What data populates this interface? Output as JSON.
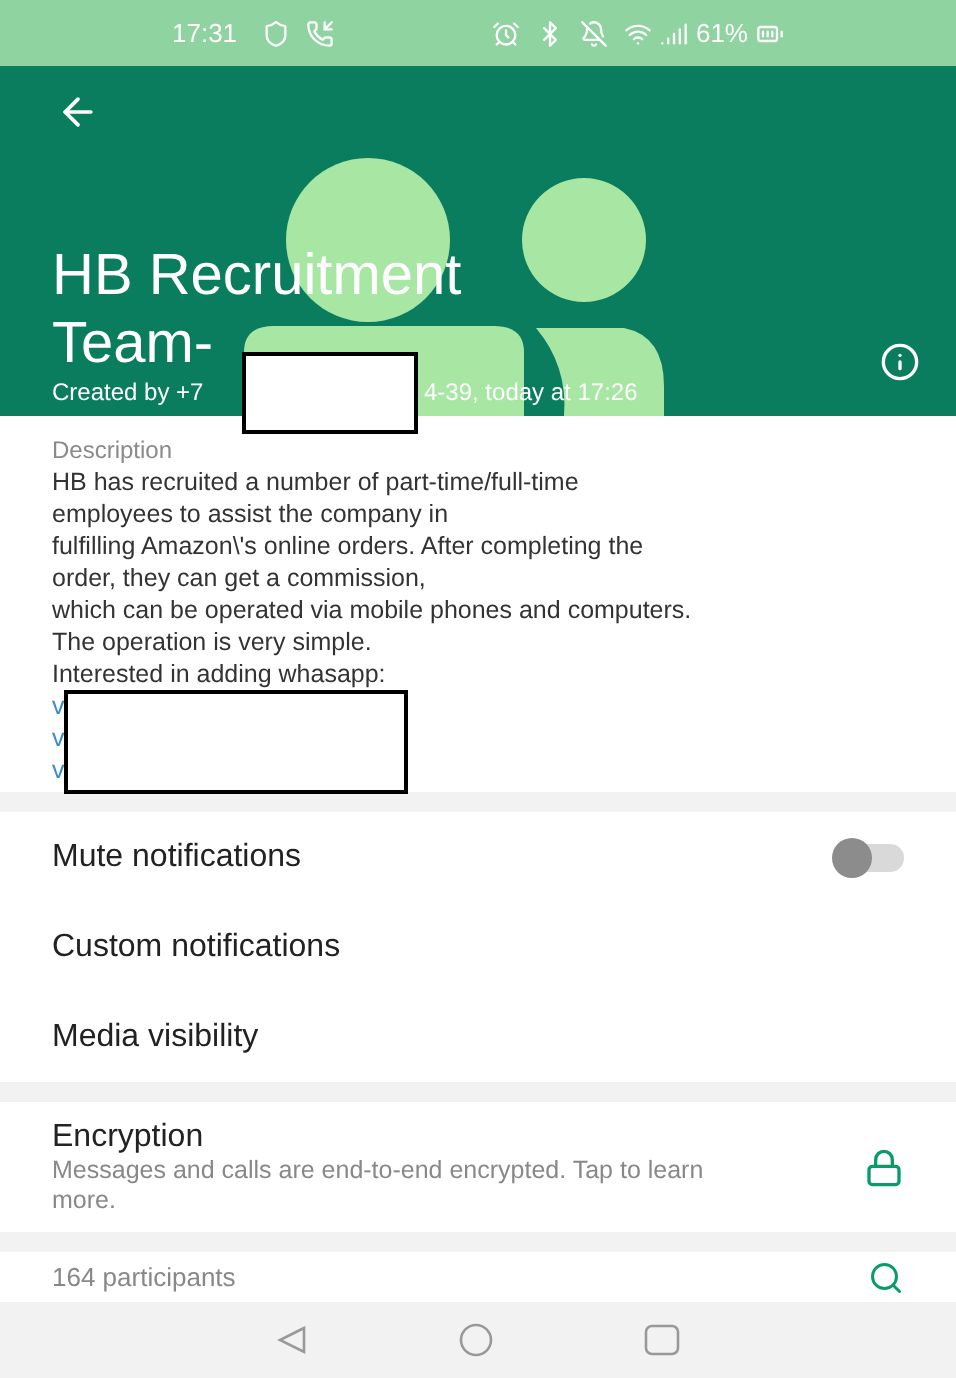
{
  "status_bar": {
    "time": "17:31",
    "battery": "61%"
  },
  "header": {
    "title_lines": [
      "HB Recruitment",
      "Team-"
    ],
    "created_parts": [
      "Created by +7",
      "4-39, today at 17:26"
    ]
  },
  "description": {
    "label": "Description",
    "lines": [
      "HB has recruited a number of part-time/full-time",
      "employees to assist the company in",
      "fulfilling Amazon\\'s online orders. After completing the",
      "order, they can get a commission,",
      "which can be operated via mobile phones and computers.",
      "The operation is very simple.",
      "Interested in adding whasapp:"
    ],
    "links": [
      "v",
      "v",
      "v"
    ]
  },
  "settings": [
    {
      "kind": "toggle",
      "label": "Mute notifications",
      "on": false
    },
    {
      "kind": "plain",
      "label": "Custom notifications"
    },
    {
      "kind": "plain",
      "label": "Media visibility"
    }
  ],
  "encryption": {
    "title": "Encryption",
    "text": "Messages and calls are end-to-end encrypted. Tap to learn more."
  },
  "participants": {
    "count": "164 participants"
  }
}
